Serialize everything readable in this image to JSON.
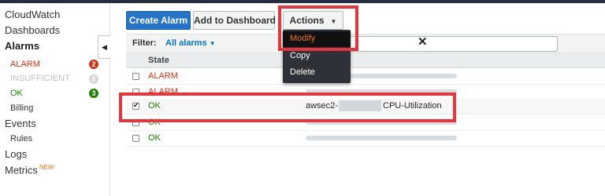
{
  "sidebar": {
    "items": [
      {
        "label": "CloudWatch"
      },
      {
        "label": "Dashboards"
      },
      {
        "label": "Alarms"
      },
      {
        "label": "ALARM",
        "count": "2"
      },
      {
        "label": "INSUFFICIENT",
        "count": "0"
      },
      {
        "label": "OK",
        "count": "3"
      },
      {
        "label": "Billing"
      },
      {
        "label": "Events"
      },
      {
        "label": "Rules"
      },
      {
        "label": "Logs"
      },
      {
        "label": "Metrics",
        "badge": "NEW"
      }
    ]
  },
  "toolbar": {
    "create_label": "Create Alarm",
    "dashboard_label": "Add to Dashboard",
    "actions_label": "Actions"
  },
  "actions_menu": {
    "items": [
      {
        "label": "Modify"
      },
      {
        "label": "Copy"
      },
      {
        "label": "Delete"
      }
    ]
  },
  "filter": {
    "label": "Filter:",
    "selected": "All alarms",
    "search_value": ""
  },
  "table": {
    "headers": [
      "State"
    ],
    "rows": [
      {
        "state": "ALARM",
        "selected": false,
        "name": ""
      },
      {
        "state": "ALARM",
        "selected": false,
        "name": ""
      },
      {
        "state": "OK",
        "selected": true,
        "name_prefix": "awsec2-",
        "name_suffix": "CPU-Utilization"
      },
      {
        "state": "OK",
        "selected": false,
        "name": ""
      },
      {
        "state": "OK",
        "selected": false,
        "name": ""
      }
    ]
  },
  "colors": {
    "primary_button": "#2574c7",
    "alarm_state": "#d13212",
    "ok_state": "#1d8102",
    "active_menu_text": "#ec7211",
    "annotation": "#e8353b"
  }
}
